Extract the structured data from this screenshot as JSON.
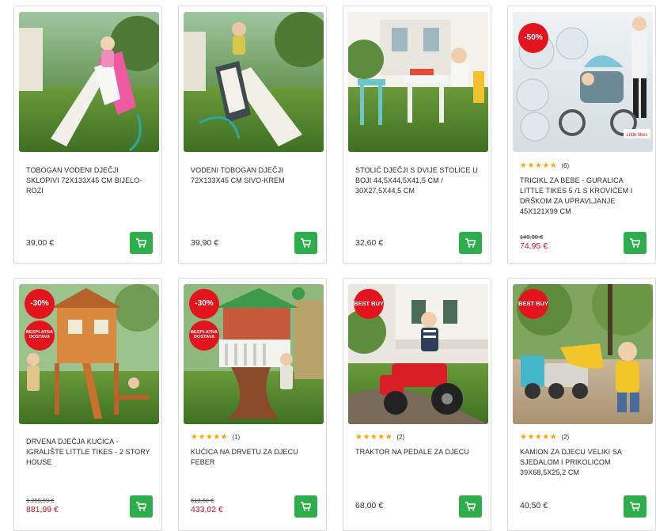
{
  "products": [
    {
      "name": "TOBOGAN VODENI DJEČJI SKLOPIVI 72x133x45 cm BIJELO-ROZI",
      "price": "39,00 €"
    },
    {
      "name": "VODENI TOBOGAN DJEČJI 72x133x45 cm SIVO-KREM",
      "price": "39,90 €"
    },
    {
      "name": "STOLIĆ DJEČJI S DVIJE STOLICE U BOJI 44,5x44,5x41,5 cm / 30x27,5x44,5 cm",
      "price": "32,60 €"
    },
    {
      "name": "TRICIKL ZA BEBE - GURALICA LITTLE TIKES 5 /1 S KROVIĆEM I DRŠKOM ZA UPRAVLJANJE 45x121x99 cm",
      "old_price": "149,90 €",
      "sale_price": "74,95 €",
      "discount": "-50%",
      "rating_count": "(6)",
      "stars": "★★★★★",
      "image_text": "Little tikes"
    },
    {
      "name": "DRVENA DJEČJA KUĆICA - IGRALIŠTE LITTLE TIKES - 2 STORY HOUSE",
      "old_price": "1.259,99 €",
      "sale_price": "881,99 €",
      "discount": "-30%",
      "shipping_badge": "BESPLATNA DOSTAVA"
    },
    {
      "name": "KUĆICA NA DRVETU ZA DJECU FEBER",
      "old_price": "618,60 €",
      "sale_price": "433,02 €",
      "discount": "-30%",
      "shipping_badge": "BESPLATNA DOSTAVA",
      "rating_count": "(1)",
      "stars": "★★★★★"
    },
    {
      "name": "TRAKTOR NA PEDALE ZA DJECU",
      "price": "68,00 €",
      "best_badge": "BEST BUY",
      "rating_count": "(2)",
      "stars": "★★★★★"
    },
    {
      "name": "KAMION ZA DJECU VELIKI SA SJEDALOM I PRIKOLICOM 39x68,5x25,2 cm",
      "price": "40,50 €",
      "best_badge": "BEST BUY",
      "rating_count": "(2)",
      "stars": "★★★★★"
    }
  ],
  "icons": {
    "cart": "shopping-cart-icon",
    "star": "star-icon"
  },
  "colors": {
    "cart_button": "#2eae4a",
    "badge": "#e3141e",
    "sale_price": "#d0101b",
    "stars": "#f6a900"
  }
}
